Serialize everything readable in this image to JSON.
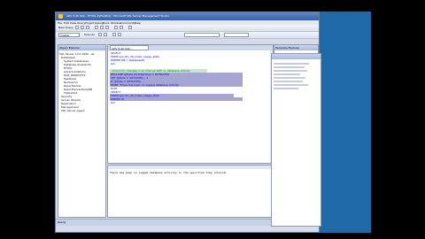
{
  "window": {
    "title": "ADV 6-4b-SQL - ETSQL.Pyfile(Brd) - Microsoft SQL Server Management Studio"
  },
  "menu": [
    "File",
    "Edit",
    "View",
    "Query",
    "Project",
    "Debug",
    "Tools",
    "Window",
    "Community",
    "Help"
  ],
  "toolbar": {
    "new_query_label": "New Query",
    "database_combo_value": "master",
    "execute_label": "Execute"
  },
  "object_explorer": {
    "title": "Object Explorer",
    "items": [
      "SQL Server 10.0.1600 - sa",
      "Databases",
      "System Databases",
      "Database Snapshots",
      "ETSQL",
      "AdventureWorks",
      "DUP_PRODUCTS",
      "Feedback",
      "Northwind",
      "ReportServer",
      "ReportServerTempDB",
      "TSQL2012",
      "Security",
      "Server Objects",
      "Replication",
      "Management",
      "SQL Server Agent"
    ]
  },
  "editor": {
    "tab_label": "ADV 6-4b-SQL...",
    "lines": [
      "SELECT",
      "FROM sys.dm_db_index_usage_stats",
      "WHERE DB = DatabaseID",
      "GO",
      "",
      "--Check for changes in an interval with no database activity",
      "DECLARE @Date AS DateTime = GETDATE()",
      "SET @Date = GETDATE() - 1",
      "IF @Date = GETDATE() ...",
      "  PRINT 'There has been no logged database activity'",
      "ELSE",
      "SELECT",
      "FROM sys.dm_db_index_usage_stats",
      "WHERE ID",
      "GO"
    ]
  },
  "results": {
    "message": "There has been no logged database activity in the specified time interval"
  },
  "properties": {
    "title": "Template Explorer"
  },
  "status": {
    "text": "Ready"
  },
  "colors": {
    "desktop": "#1e6aa8",
    "titlebar": "#3b62a8",
    "highlight": "#a5a4d4"
  }
}
